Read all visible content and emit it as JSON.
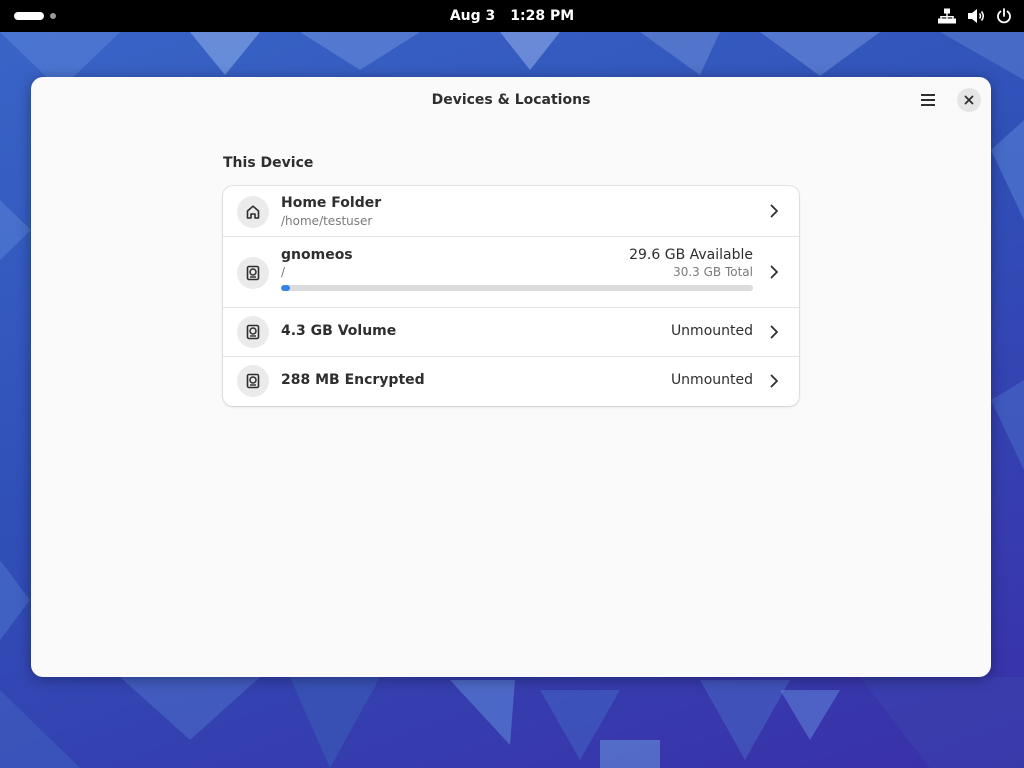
{
  "topbar": {
    "date": "Aug 3",
    "time": "1:28 PM",
    "icons": [
      "network-icon",
      "volume-icon",
      "power-icon"
    ]
  },
  "window": {
    "title": "Devices & Locations",
    "section_title": "This Device",
    "items": [
      {
        "title": "Home Folder",
        "subtitle": "/home/testuser",
        "icon": "home-icon"
      },
      {
        "title": "gnomeos",
        "subtitle": "/",
        "available": "29.6 GB Available",
        "total": "30.3 GB Total",
        "usage_fraction": 0.02,
        "icon": "drive-icon"
      },
      {
        "title": "4.3 GB Volume",
        "status": "Unmounted",
        "icon": "drive-icon"
      },
      {
        "title": "288 MB Encrypted",
        "status": "Unmounted",
        "icon": "drive-icon"
      }
    ]
  },
  "colors": {
    "accent": "#3584e4",
    "window_bg": "#fafafa",
    "topbar_bg": "#000000"
  }
}
